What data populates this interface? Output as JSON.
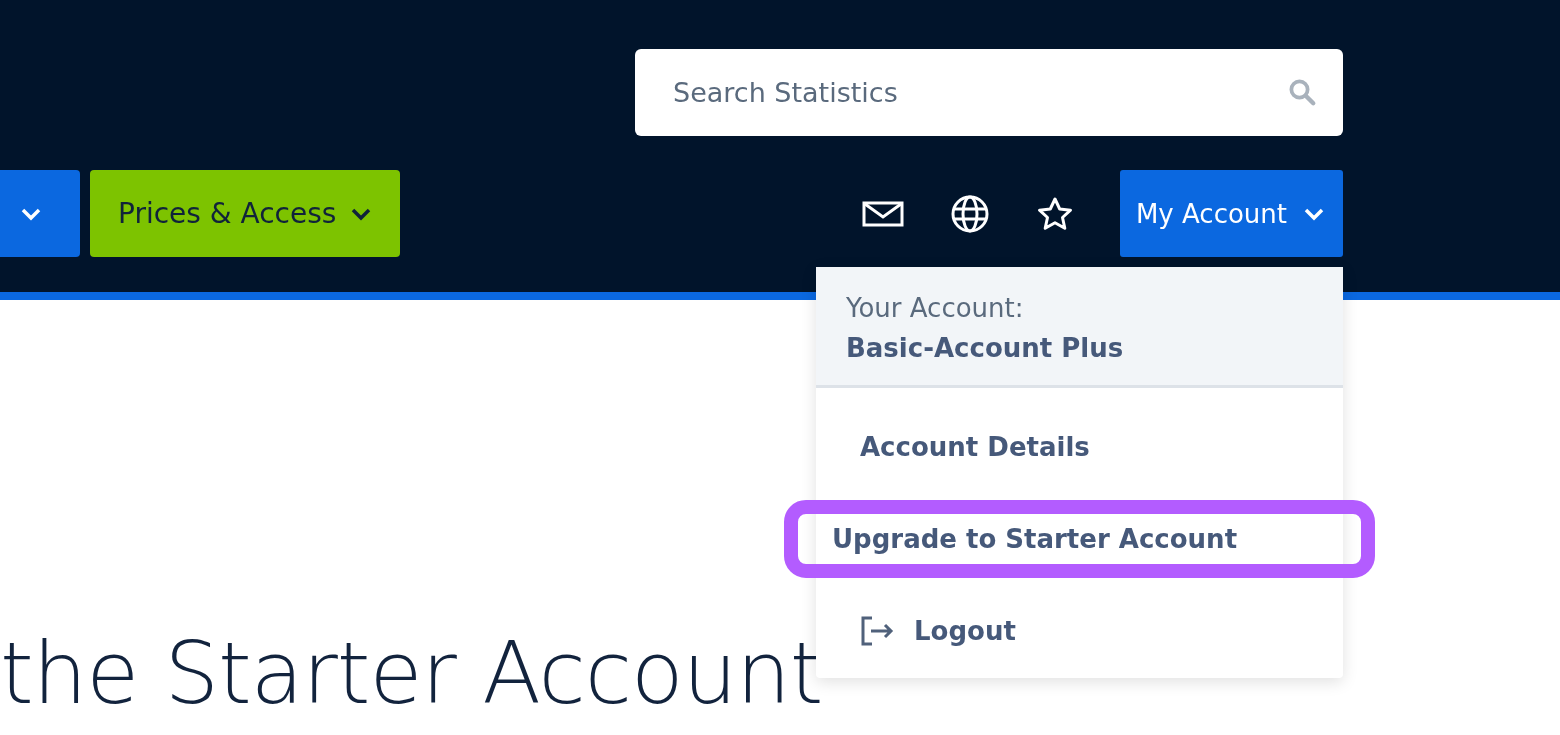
{
  "search": {
    "placeholder": "Search Statistics"
  },
  "nav": [
    {
      "kind": "cut",
      "color": "#0b68e0"
    },
    {
      "label": "Prices & Access",
      "kind": "menu",
      "color": "#7dc300"
    }
  ],
  "account_button": {
    "label": "My Account",
    "expanded": true
  },
  "account_menu": {
    "caption": "Your Account:",
    "plan": "Basic-Account Plus",
    "items": [
      {
        "label": "Account Details",
        "kind": "link",
        "highlighted": false
      },
      {
        "label": "Upgrade to Starter Account",
        "kind": "link",
        "highlighted": true
      },
      {
        "label": "Logout",
        "kind": "logout",
        "highlighted": false
      }
    ]
  },
  "heading": "the Starter Account"
}
